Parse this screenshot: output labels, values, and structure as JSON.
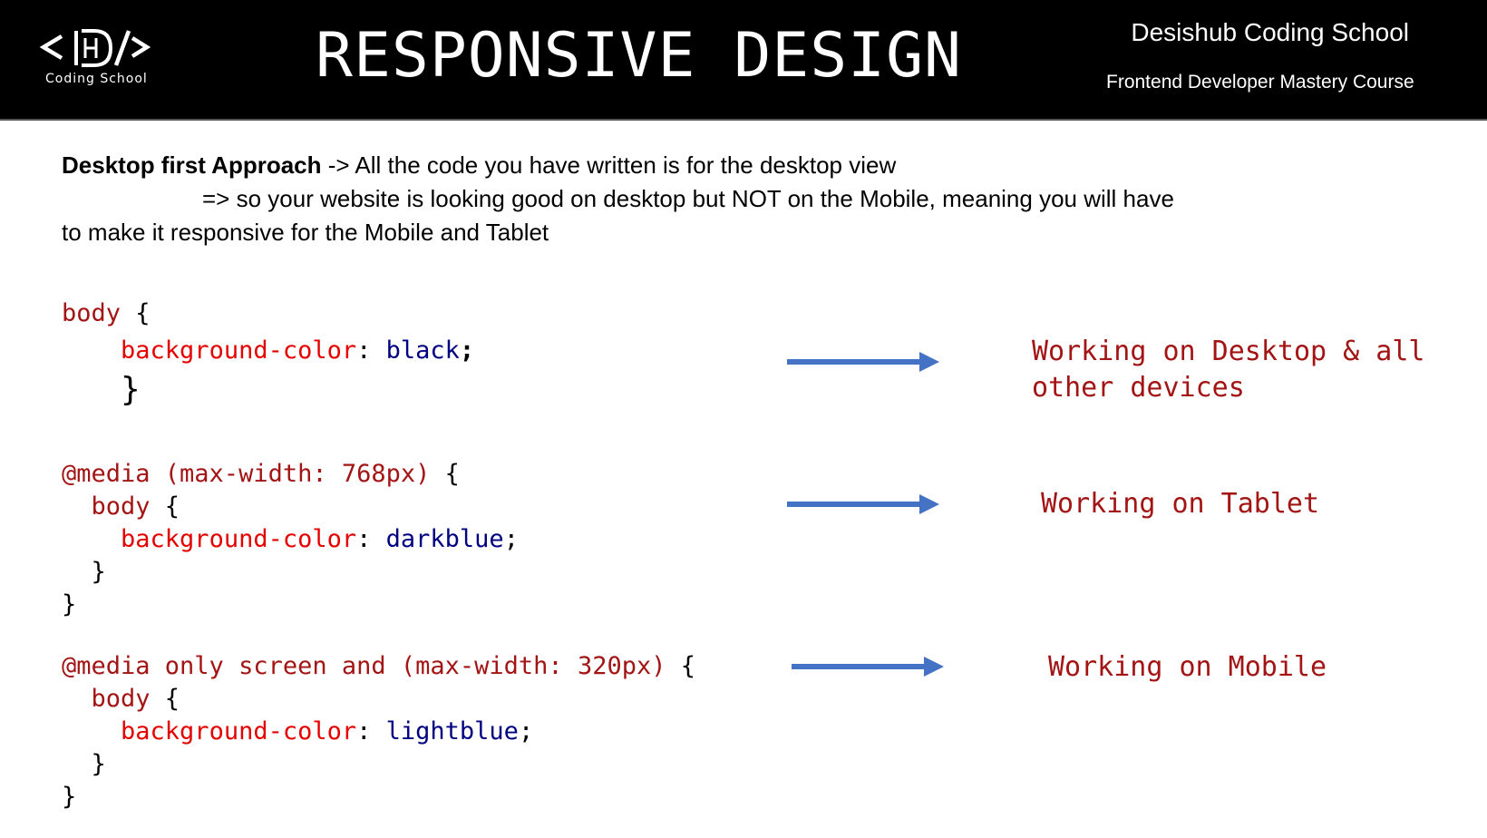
{
  "header": {
    "logo": {
      "icon": "desishub-code-logo-icon",
      "caption": "Coding School"
    },
    "title": "RESPONSIVE DESIGN",
    "school_name": "Desishub Coding School",
    "course_name": "Frontend Developer Mastery Course"
  },
  "intro": {
    "heading_bold": "Desktop first Approach",
    "line1_rest": " -> All the code you have written is for the desktop view",
    "line2": "=> so your website is looking good on desktop but NOT on the Mobile, meaning you will have",
    "line3": "to make it responsive for the Mobile and Tablet"
  },
  "colors": {
    "header_bg": "#000000",
    "selector": "#a31515",
    "property": "#e50000",
    "value": "#000080",
    "arrow": "#4472c4",
    "note": "#a31515"
  },
  "examples": [
    {
      "code": {
        "selector": "body",
        "open": " {",
        "property": "background-color",
        "colon": ": ",
        "value": "black",
        "semi": ";",
        "close": "}"
      },
      "arrow_icon": "right-arrow-icon",
      "note_line1": "Working on Desktop & all",
      "note_line2": "other devices"
    },
    {
      "code": {
        "at_rule": "@media (max-width: 768px)",
        "open": " {",
        "selector": "body",
        "inner_open": " {",
        "property": "background-color",
        "colon": ": ",
        "value": "darkblue",
        "semi": ";",
        "inner_close": "}",
        "close": "}"
      },
      "arrow_icon": "right-arrow-icon",
      "note_line1": "Working on Tablet"
    },
    {
      "code": {
        "at_rule": "@media only screen and (max-width: 320px)",
        "open": " {",
        "selector": "body",
        "inner_open": " {",
        "property": "background-color",
        "colon": ": ",
        "value": "lightblue",
        "semi": ";",
        "inner_close": "}",
        "close": "}"
      },
      "arrow_icon": "right-arrow-icon",
      "note_line1": "Working on Mobile"
    }
  ]
}
